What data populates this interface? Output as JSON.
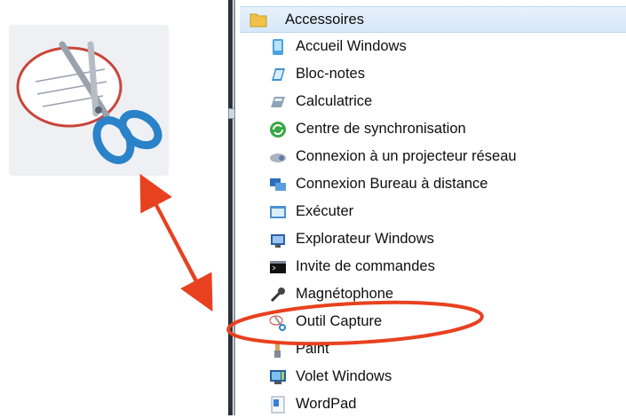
{
  "menu": {
    "folder_label": "Accessoires",
    "items": [
      {
        "label": "Accueil Windows",
        "icon": "device-icon"
      },
      {
        "label": "Bloc-notes",
        "icon": "notepad-icon"
      },
      {
        "label": "Calculatrice",
        "icon": "calculator-icon"
      },
      {
        "label": "Centre de synchronisation",
        "icon": "sync-center-icon"
      },
      {
        "label": "Connexion à un projecteur réseau",
        "icon": "network-projector-icon"
      },
      {
        "label": "Connexion Bureau à distance",
        "icon": "remote-desktop-icon"
      },
      {
        "label": "Exécuter",
        "icon": "run-icon"
      },
      {
        "label": "Explorateur Windows",
        "icon": "windows-explorer-icon"
      },
      {
        "label": "Invite de commandes",
        "icon": "command-prompt-icon"
      },
      {
        "label": "Magnétophone",
        "icon": "microphone-icon"
      },
      {
        "label": "Outil Capture",
        "icon": "snipping-tool-icon"
      },
      {
        "label": "Paint",
        "icon": "paint-icon"
      },
      {
        "label": "Volet Windows",
        "icon": "windows-sidebar-icon"
      },
      {
        "label": "WordPad",
        "icon": "wordpad-icon"
      }
    ]
  },
  "highlight": {
    "target": "Outil Capture",
    "color": "#e8411f"
  },
  "logo": {
    "icon": "snipping-tool-logo"
  }
}
